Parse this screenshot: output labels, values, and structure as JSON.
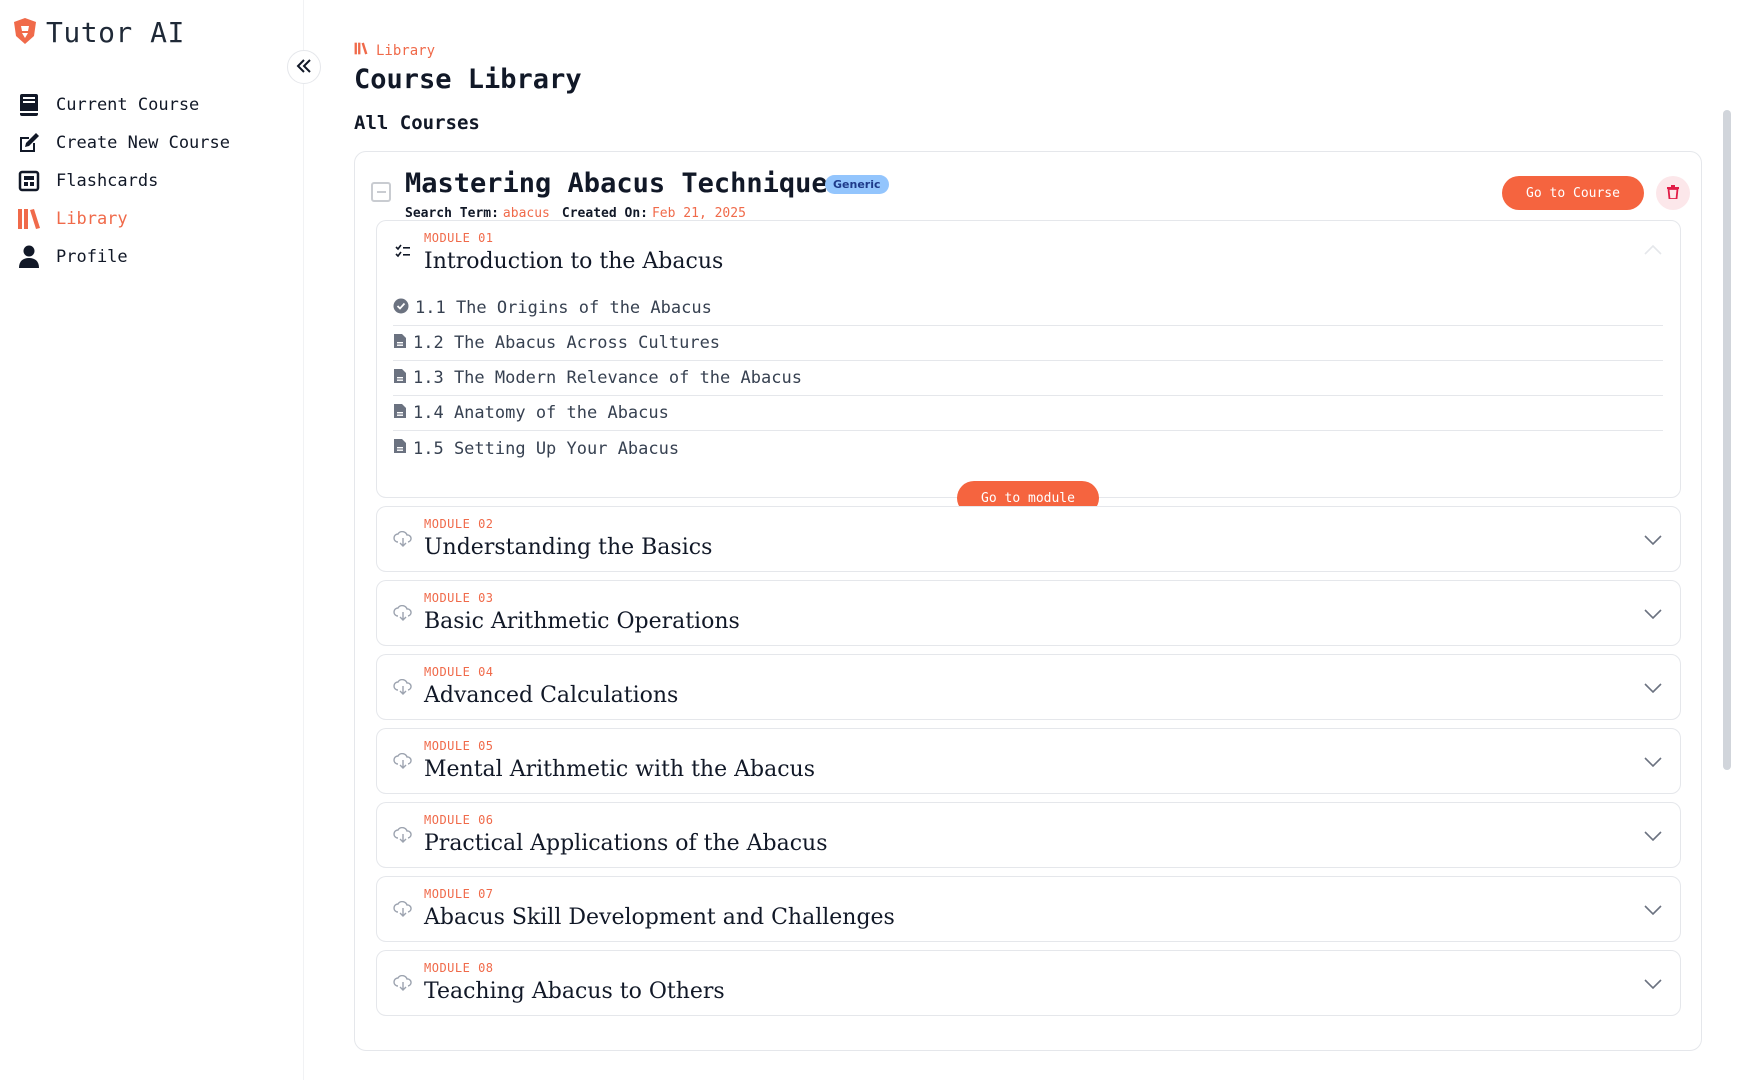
{
  "app": {
    "name": "Tutor AI"
  },
  "sidebar": {
    "items": [
      {
        "label": "Current Course",
        "icon": "book-icon"
      },
      {
        "label": "Create New Course",
        "icon": "edit-icon"
      },
      {
        "label": "Flashcards",
        "icon": "flashcards-icon"
      },
      {
        "label": "Library",
        "icon": "library-icon",
        "active": true
      },
      {
        "label": "Profile",
        "icon": "user-icon"
      }
    ]
  },
  "header": {
    "breadcrumb": "Library",
    "title": "Course Library",
    "section": "All Courses"
  },
  "course": {
    "title": "Mastering Abacus Techniques",
    "badge": "Generic",
    "search_term_label": "Search Term:",
    "search_term": "abacus",
    "created_label": "Created On:",
    "created_on": "Feb 21, 2025",
    "go_label": "Go to Course",
    "modules": [
      {
        "number": "MODULE 01",
        "title": "Introduction to the Abacus",
        "expanded": true,
        "lessons": [
          {
            "label": "1.1 The Origins of the Abacus",
            "status": "completed"
          },
          {
            "label": "1.2 The Abacus Across Cultures",
            "status": "document"
          },
          {
            "label": "1.3 The Modern Relevance of the Abacus",
            "status": "document"
          },
          {
            "label": "1.4 Anatomy of the Abacus",
            "status": "document"
          },
          {
            "label": "1.5 Setting Up Your Abacus",
            "status": "document"
          }
        ],
        "go_label": "Go to module"
      },
      {
        "number": "MODULE 02",
        "title": "Understanding the Basics"
      },
      {
        "number": "MODULE 03",
        "title": "Basic Arithmetic Operations"
      },
      {
        "number": "MODULE 04",
        "title": "Advanced Calculations"
      },
      {
        "number": "MODULE 05",
        "title": "Mental Arithmetic with the Abacus"
      },
      {
        "number": "MODULE 06",
        "title": "Practical Applications of the Abacus"
      },
      {
        "number": "MODULE 07",
        "title": "Abacus Skill Development and Challenges"
      },
      {
        "number": "MODULE 08",
        "title": "Teaching Abacus to Others"
      }
    ]
  },
  "colors": {
    "accent": "#f5643f",
    "badge": "#93c5fd"
  }
}
